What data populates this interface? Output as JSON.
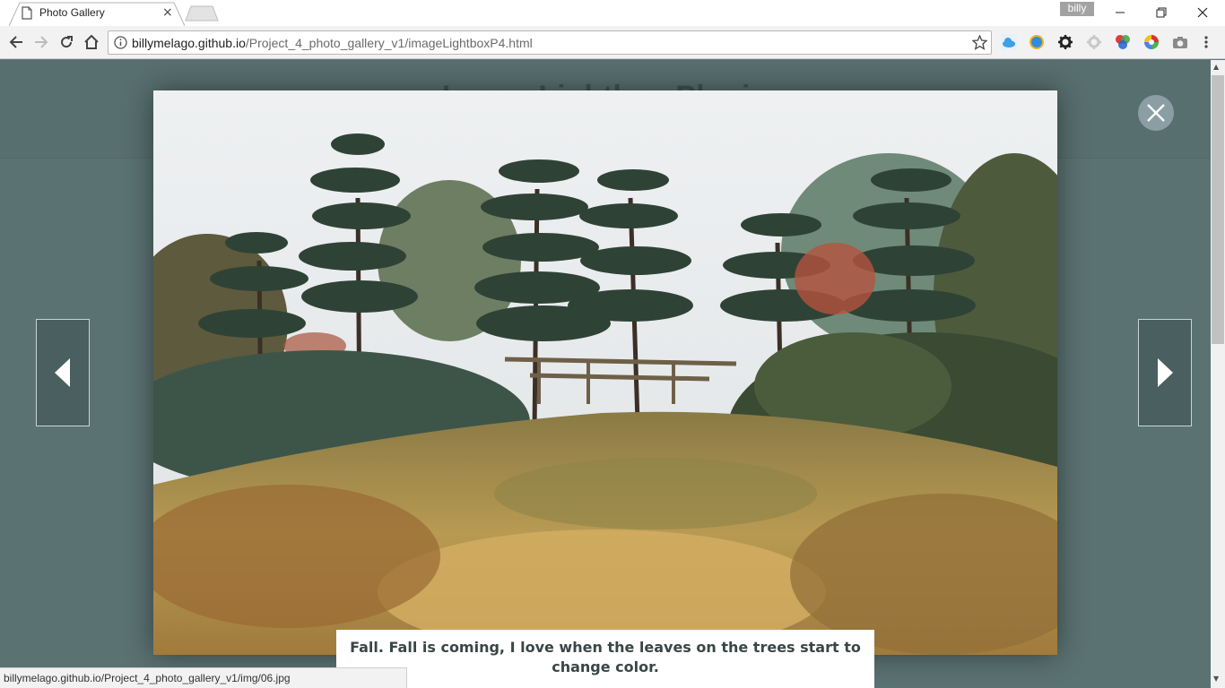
{
  "browser": {
    "tab_title": "Photo Gallery",
    "tab_close": "×",
    "profile_name": "billy",
    "url_host": "billymelago.github.io",
    "url_path": "/Project_4_photo_gallery_v1/imageLightboxP4.html",
    "status_url": "billymelago.github.io/Project_4_photo_gallery_v1/img/06.jpg"
  },
  "page": {
    "title": "Image Lightbox Plugin"
  },
  "lightbox": {
    "caption": "Fall. Fall is coming, I love when the leaves on the trees start to change color.",
    "image_icon": "garden-photo",
    "close_icon": "close-icon",
    "prev_icon": "arrow-left-icon",
    "next_icon": "arrow-right-icon"
  },
  "colors": {
    "page_bg": "#5f7777",
    "nav_button_bg": "#4a5f5f",
    "close_button_bg": "#8a9ea4"
  }
}
